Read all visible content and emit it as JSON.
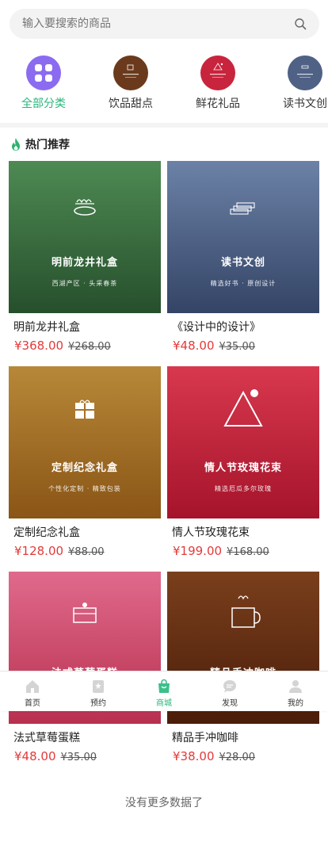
{
  "search": {
    "placeholder": "输入要搜索的商品"
  },
  "categories": [
    {
      "label": "全部分类",
      "active": true,
      "icon": "grid-icon",
      "color": "#8b6bf0"
    },
    {
      "label": "饮品甜点",
      "icon": "cup-icon",
      "color": "#6b3a1c"
    },
    {
      "label": "鲜花礼品",
      "icon": "flower-icon",
      "color": "#c9243d"
    },
    {
      "label": "读书文创",
      "icon": "book-icon",
      "color": "#4f6185"
    }
  ],
  "section": {
    "title": "热门推荐",
    "icon": "flame-icon"
  },
  "products": [
    {
      "name": "明前龙井礼盒",
      "img_title": "明前龙井礼盒",
      "img_sub": "西湖产区 · 头采春茶",
      "price": "¥368.00",
      "old_price": "¥268.00",
      "icon": "tea-icon",
      "colors": [
        "#4e8a53",
        "#264f2c"
      ]
    },
    {
      "name": "《设计中的设计》",
      "img_title": "读书文创",
      "img_sub": "精选好书 · 原创设计",
      "price": "¥48.00",
      "old_price": "¥35.00",
      "icon": "books-icon",
      "colors": [
        "#6b82a6",
        "#344466"
      ]
    },
    {
      "name": "定制纪念礼盒",
      "img_title": "定制纪念礼盒",
      "img_sub": "个性化定制 · 精致包装",
      "price": "¥128.00",
      "old_price": "¥88.00",
      "icon": "gift-icon",
      "colors": [
        "#b78838",
        "#8a5516"
      ]
    },
    {
      "name": "情人节玫瑰花束",
      "img_title": "情人节玫瑰花束",
      "img_sub": "精选厄瓜多尔玫瑰",
      "price": "¥199.00",
      "old_price": "¥168.00",
      "icon": "mountain-icon",
      "colors": [
        "#d8384e",
        "#a5142b"
      ]
    },
    {
      "name": "法式草莓蛋糕",
      "img_title": "法式草莓蛋糕",
      "img_sub": "",
      "price": "¥48.00",
      "old_price": "¥35.00",
      "icon": "cake-icon",
      "colors": [
        "#e06a8c",
        "#b8304f"
      ]
    },
    {
      "name": "精品手冲咖啡",
      "img_title": "精品手冲咖啡",
      "img_sub": "",
      "price": "¥38.00",
      "old_price": "¥28.00",
      "icon": "coffee-icon",
      "colors": [
        "#7a3f1c",
        "#4a1d0a"
      ]
    }
  ],
  "footer": {
    "no_more": "没有更多数据了"
  },
  "tabbar": [
    {
      "label": "首页",
      "icon": "home-icon"
    },
    {
      "label": "预约",
      "icon": "bookmark-icon"
    },
    {
      "label": "商城",
      "icon": "shopping-bag-icon",
      "active": true
    },
    {
      "label": "发现",
      "icon": "chat-icon"
    },
    {
      "label": "我的",
      "icon": "user-icon"
    }
  ]
}
